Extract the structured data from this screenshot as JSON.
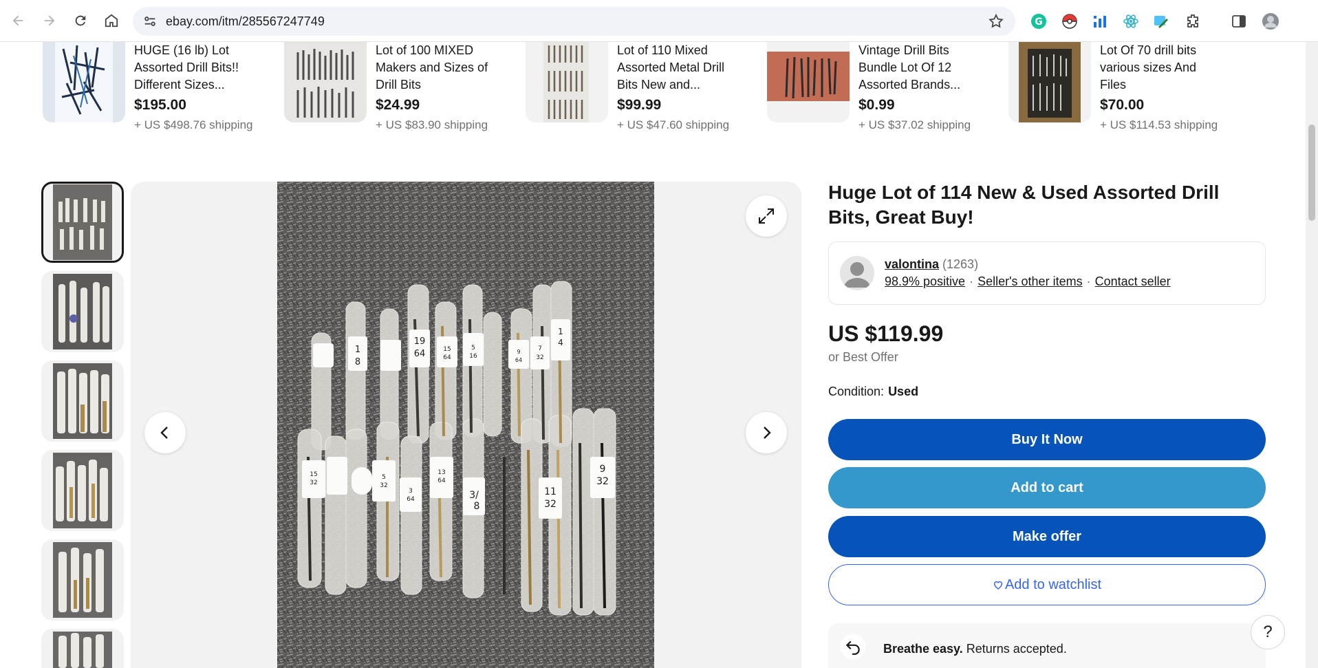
{
  "browser": {
    "url": "ebay.com/itm/285567247749",
    "icons": [
      "back-icon",
      "forward-icon",
      "reload-icon",
      "home-icon",
      "site-info-icon",
      "bookmark-star-icon",
      "grammarly-icon",
      "pokeball-icon",
      "chart-extension-icon",
      "react-devtools-icon",
      "color-picker-icon",
      "extensions-icon",
      "side-panel-icon",
      "profile-avatar"
    ]
  },
  "similar_items": [
    {
      "title": "HUGE (16 lb) Lot Assorted Drill Bits!! Different Sizes...",
      "price": "$195.00",
      "shipping": "+ US $498.76 shipping"
    },
    {
      "title": "Lot of 100 MIXED Makers and Sizes of Drill Bits",
      "price": "$24.99",
      "shipping": "+ US $83.90 shipping"
    },
    {
      "title": "Lot of 110 Mixed Assorted Metal Drill Bits New and...",
      "price": "$99.99",
      "shipping": "+ US $47.60 shipping"
    },
    {
      "title": "Vintage Drill Bits Bundle Lot Of 12 Assorted Brands...",
      "price": "$0.99",
      "shipping": "+ US $37.02 shipping"
    },
    {
      "title": "Lot Of 70 drill bits various sizes And Files",
      "price": "$70.00",
      "shipping": "+ US $114.53 shipping"
    }
  ],
  "listing": {
    "title": "Huge Lot of 114 New & Used Assorted Drill Bits, Great Buy!",
    "seller": {
      "name": "valontina",
      "feedback_count": "(1263)",
      "positive": "98.9% positive",
      "other_items": "Seller's other items",
      "contact": "Contact seller"
    },
    "price": "US $119.99",
    "best_offer": "or Best Offer",
    "condition_label": "Condition:",
    "condition_value": "Used",
    "buttons": {
      "buy_now": "Buy It Now",
      "add_to_cart": "Add to cart",
      "make_offer": "Make offer",
      "watchlist": "Add to watchlist"
    },
    "returns": {
      "bold": "Breathe easy.",
      "text": " Returns accepted."
    },
    "help": "?"
  },
  "colors": {
    "primary_blue": "#0654ba",
    "cart_blue": "#3498ca",
    "link_blue": "#3665f3"
  }
}
